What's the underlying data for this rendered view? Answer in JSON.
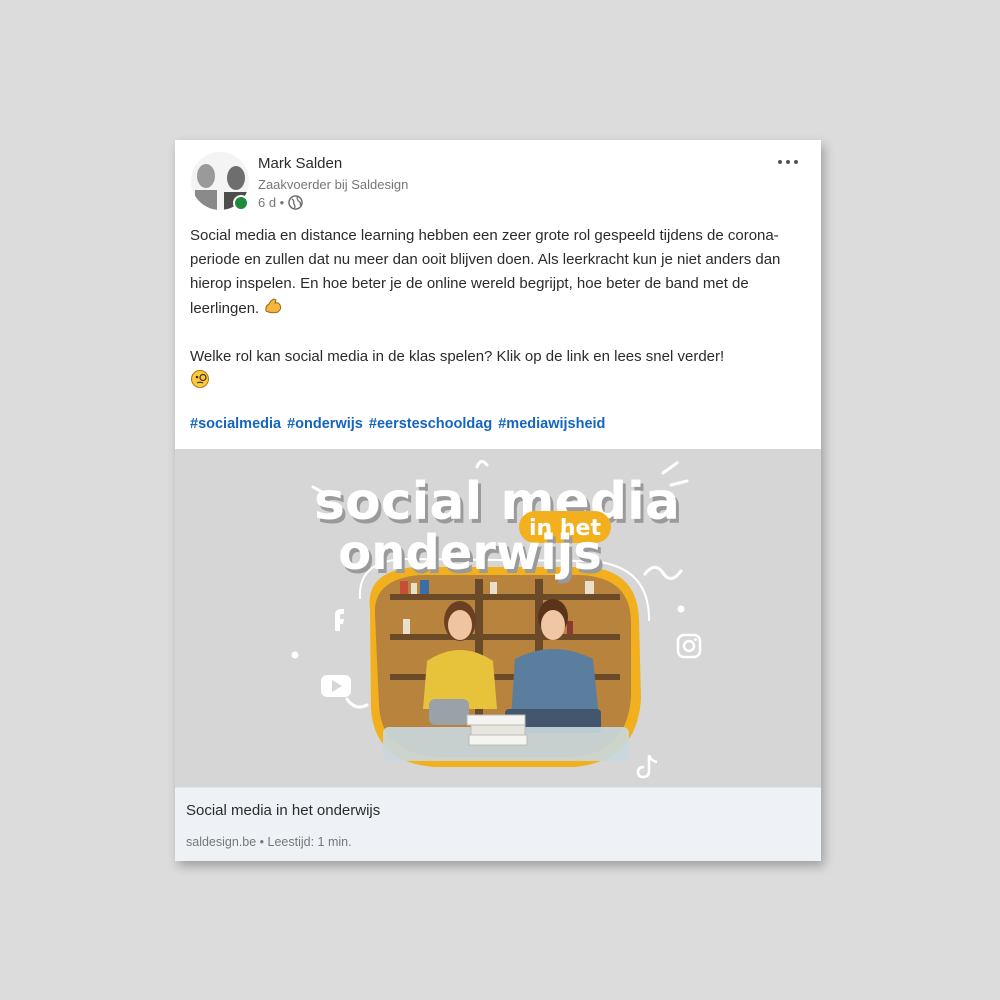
{
  "post": {
    "author_name": "Mark Salden",
    "author_title": "Zaakvoerder bij Saldesign",
    "age": "6 d •",
    "paragraph1": "Social media en distance learning hebben een zeer grote rol gespeeld tijdens de corona-periode en zullen dat nu meer dan ooit blijven doen. Als leerkracht kun je niet anders dan hierop inspelen. En hoe beter je de online wereld begrijpt, hoe beter de band met de leerlingen.",
    "paragraph2": "Welke rol kan social media in de klas spelen? Klik op de link en lees snel verder!",
    "hashtags": [
      "#socialmedia",
      "#onderwijs",
      "#eersteschooldag",
      "#mediawijsheid"
    ],
    "icons": {
      "more": "more-options-icon",
      "visibility": "globe-icon",
      "emoji1": "flexed-biceps-emoji",
      "emoji2": "face-with-monocle-emoji"
    }
  },
  "image": {
    "headline_line1": "social media",
    "headline_badge": "in het",
    "headline_line2": "onderwijs",
    "social_icons": [
      "facebook-icon",
      "youtube-icon",
      "instagram-icon",
      "tiktok-icon"
    ]
  },
  "link_preview": {
    "title": "Social media in het onderwijs",
    "meta": "saldesign.be • Leestijd: 1 min."
  },
  "colors": {
    "link": "#1565c0",
    "online": "#1f8a3b",
    "badge": "#f2b01e",
    "background": "#dcdcdc"
  }
}
